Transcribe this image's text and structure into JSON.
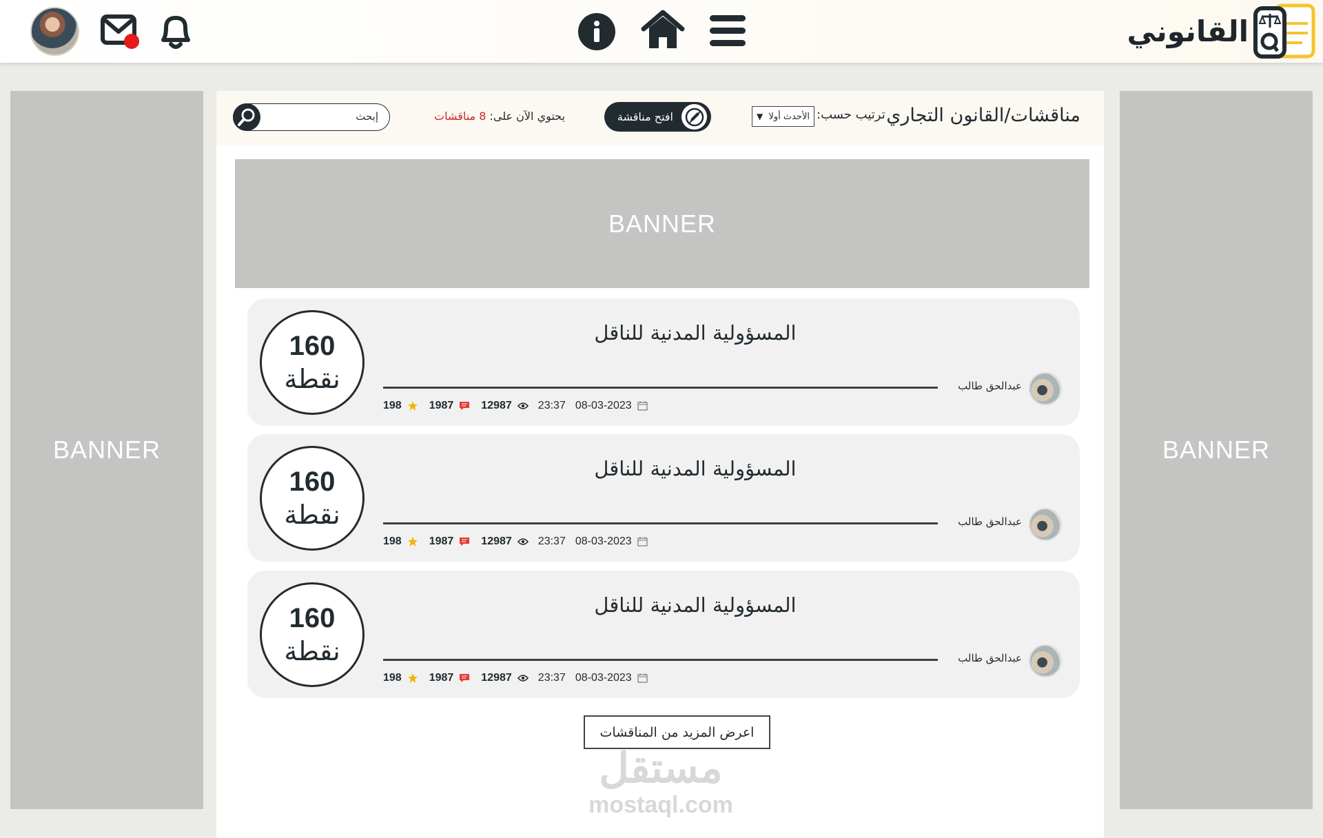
{
  "header": {
    "logo_text": "القانوني",
    "icons": [
      "avatar",
      "mail-icon",
      "bell-icon",
      "info-icon",
      "home-icon",
      "menu-icon"
    ],
    "mail_has_unread": true
  },
  "banners": {
    "left": "BANNER",
    "right": "BANNER",
    "top": "BANNER"
  },
  "toolbar": {
    "page_title": "مناقشات/القانون التجاري",
    "sort_label": "ترتيب حسب:",
    "sort_selected": "الأحدث أولا",
    "open_button_label": "افتح مناقشة",
    "count_prefix": "يحتوي الآن على:",
    "count_value": "8 مناقشات",
    "search_placeholder": "إبحث"
  },
  "discussions": [
    {
      "title": "المسؤولية المدنية للناقل",
      "points": "160",
      "points_unit": "نقطة",
      "author": "عبدالحق طالب",
      "date": "08-03-2023",
      "time": "23:37",
      "views": "12987",
      "comments": "1987",
      "rating": "198"
    },
    {
      "title": "المسؤولية المدنية للناقل",
      "points": "160",
      "points_unit": "نقطة",
      "author": "عبدالحق طالب",
      "date": "08-03-2023",
      "time": "23:37",
      "views": "12987",
      "comments": "1987",
      "rating": "198"
    },
    {
      "title": "المسؤولية المدنية للناقل",
      "points": "160",
      "points_unit": "نقطة",
      "author": "عبدالحق طالب",
      "date": "08-03-2023",
      "time": "23:37",
      "views": "12987",
      "comments": "1987",
      "rating": "198"
    }
  ],
  "more_button_label": "اعرض المزيد من المناقشات",
  "watermark": {
    "arabic": "مستقل",
    "latin": "mostaql.com"
  },
  "colors": {
    "dark": "#222b30",
    "accent_yellow": "#f4c430",
    "notification_red": "#e31b1b",
    "banner_gray": "#c4c5c3",
    "card_bg": "#f1f1f1"
  }
}
